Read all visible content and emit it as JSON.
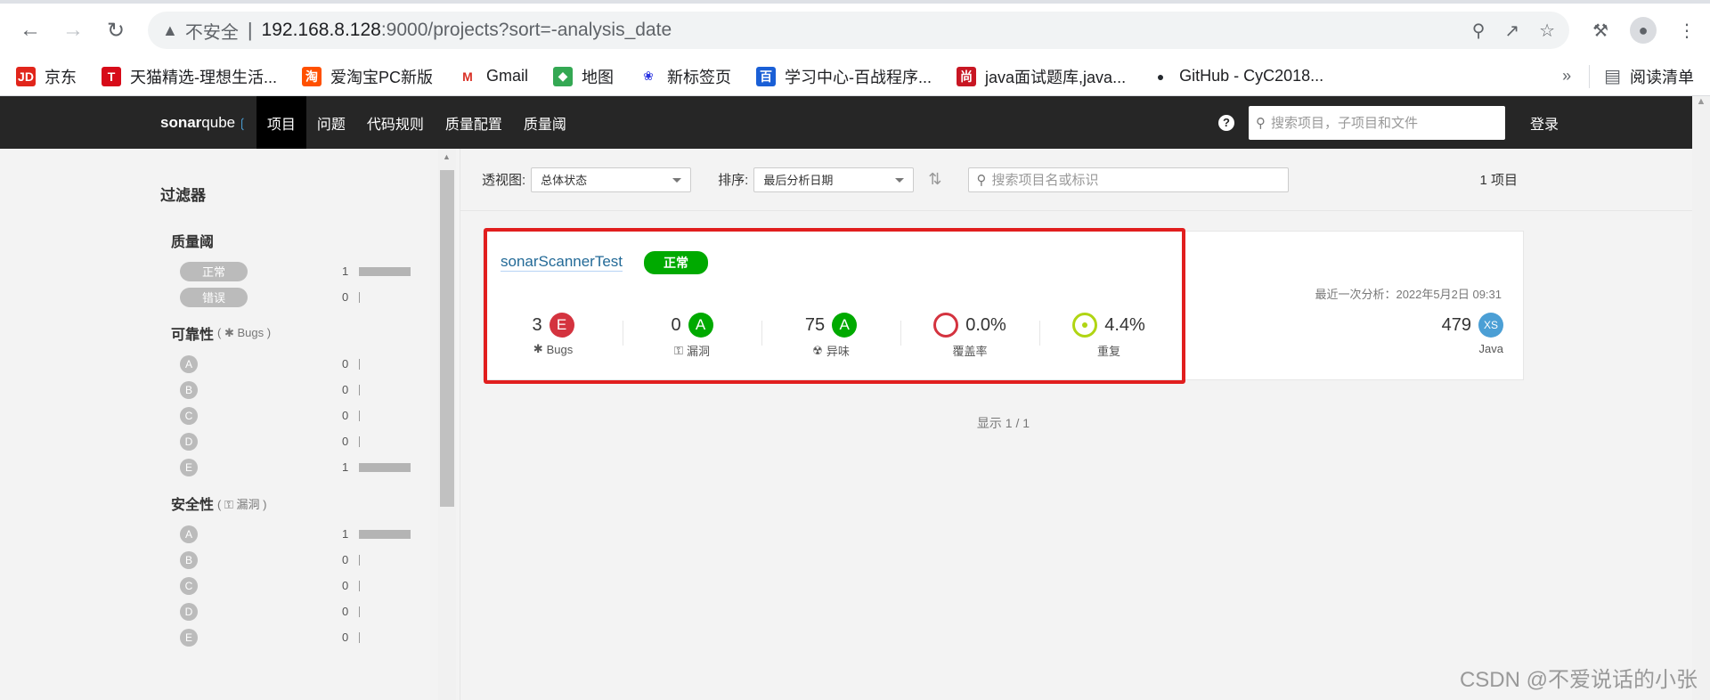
{
  "browser": {
    "insecure_label": "不安全",
    "url_host": "192.168.8.128",
    "url_rest": ":9000/projects?sort=-analysis_date",
    "bookmarks": [
      {
        "label": "京东",
        "icon": "jd-icon",
        "color": "#e1251b"
      },
      {
        "label": "天猫精选-理想生活...",
        "icon": "tmall-icon",
        "color": "#d70b19"
      },
      {
        "label": "爱淘宝PC新版",
        "icon": "taobao-icon",
        "color": "#ff5000"
      },
      {
        "label": "Gmail",
        "icon": "gmail-icon",
        "color": "#ffffff"
      },
      {
        "label": "地图",
        "icon": "maps-icon",
        "color": "#34a853"
      },
      {
        "label": "新标签页",
        "icon": "baidu-icon",
        "color": "#ffffff"
      },
      {
        "label": "学习中心-百战程序...",
        "icon": "bz-icon",
        "color": "#1a5fd6"
      },
      {
        "label": "java面试题库,java...",
        "icon": "shang-icon",
        "color": "#c81623"
      },
      {
        "label": "GitHub - CyC2018...",
        "icon": "github-icon",
        "color": "#ffffff"
      }
    ],
    "more": "»",
    "reading_list": "阅读清单"
  },
  "sonar": {
    "logo_sonar": "sonar",
    "logo_qube": "qube",
    "nav": [
      "项目",
      "问题",
      "代码规则",
      "质量配置",
      "质量阈"
    ],
    "search_placeholder": "搜索项目，子项目和文件",
    "login": "登录"
  },
  "filters": {
    "title": "过滤器",
    "quality_gate": {
      "title": "质量阈",
      "rows": [
        {
          "label": "正常",
          "count": "1",
          "fraction": 1
        },
        {
          "label": "错误",
          "count": "0",
          "fraction": 0
        }
      ]
    },
    "reliability": {
      "title": "可靠性",
      "sub": "Bugs",
      "rows": [
        {
          "label": "A",
          "count": "0",
          "fraction": 0
        },
        {
          "label": "B",
          "count": "0",
          "fraction": 0
        },
        {
          "label": "C",
          "count": "0",
          "fraction": 0
        },
        {
          "label": "D",
          "count": "0",
          "fraction": 0
        },
        {
          "label": "E",
          "count": "1",
          "fraction": 1
        }
      ]
    },
    "security": {
      "title": "安全性",
      "sub": "漏洞",
      "rows": [
        {
          "label": "A",
          "count": "1",
          "fraction": 1
        },
        {
          "label": "B",
          "count": "0",
          "fraction": 0
        },
        {
          "label": "C",
          "count": "0",
          "fraction": 0
        },
        {
          "label": "D",
          "count": "0",
          "fraction": 0
        },
        {
          "label": "E",
          "count": "0",
          "fraction": 0
        }
      ]
    }
  },
  "toolbar": {
    "perspective_label": "透视图:",
    "perspective_value": "总体状态",
    "sort_label": "排序:",
    "sort_value": "最后分析日期",
    "search_placeholder": "搜索项目名或标识",
    "count": "1 项目"
  },
  "project": {
    "name": "sonarScannerTest",
    "status": "正常",
    "last_analysis": "最近一次分析：2022年5月2日 09:31",
    "metrics": {
      "bugs": {
        "value": "3",
        "grade": "E",
        "label": "Bugs"
      },
      "vulns": {
        "value": "0",
        "grade": "A",
        "label": "漏洞"
      },
      "smells": {
        "value": "75",
        "grade": "A",
        "label": "异味"
      },
      "coverage": {
        "value": "0.0%",
        "label": "覆盖率"
      },
      "duplication": {
        "value": "4.4%",
        "label": "重复"
      }
    },
    "size": {
      "value": "479",
      "badge": "XS",
      "label": "Java"
    }
  },
  "pagination": "显示 1 / 1",
  "watermark": "CSDN @不爱说话的小张"
}
